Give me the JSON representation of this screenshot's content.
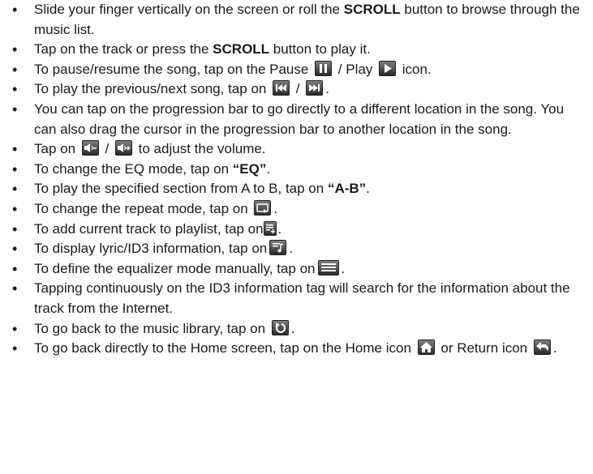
{
  "items": [
    {
      "t1": "Slide your finger vertically on the screen or roll the ",
      "b1": "SCROLL",
      "t2": " button to browse through the music list."
    },
    {
      "t1": "Tap on the track or press the ",
      "b1": "SCROLL",
      "t2": " button to play it."
    },
    {
      "t1": "To pause/resume the song, tap on the Pause ",
      "t2": " / Play ",
      "t3": " icon."
    },
    {
      "t1": "To play the previous/next song, tap on ",
      "t2": " / ",
      "t3": "."
    },
    {
      "t1": "You can tap on the progression bar to go directly to a different location in the song. You can also drag the cursor in the progression bar to another location in the song."
    },
    {
      "t1": "Tap on ",
      "t2": " / ",
      "t3": " to adjust the volume."
    },
    {
      "t1": "To change the EQ mode, tap on ",
      "b1": "“EQ”",
      "t2": "."
    },
    {
      "t1": "To play the specified section from A to B, tap on ",
      "b1": "“A-B”",
      "t2": "."
    },
    {
      "t1": "To change the repeat mode, tap on ",
      "t2": "."
    },
    {
      "t1": "To add current track to playlist, tap on",
      "t2": "."
    },
    {
      "t1": "To display lyric/ID3 information, tap on",
      "t2": "."
    },
    {
      "t1": "To define the equalizer mode manually, tap on",
      "t2": "."
    },
    {
      "t1": "Tapping continuously on the ID3 information tag will search for the information about the track from the Internet."
    },
    {
      "t1": "To go back to the music library, tap on ",
      "t2": "."
    },
    {
      "t1": "To go back directly to the Home screen, tap on the Home icon ",
      "t2": " or Return icon ",
      "t3": "."
    }
  ],
  "icons": {
    "pause": "pause-icon",
    "play": "play-icon",
    "previous": "previous-track-icon",
    "next": "next-track-icon",
    "volume_down": "volume-down-icon",
    "volume_up": "volume-up-icon",
    "repeat": "repeat-icon",
    "add_playlist": "add-to-playlist-icon",
    "lyrics": "lyrics-id3-icon",
    "equalizer": "equalizer-icon",
    "library": "back-to-library-icon",
    "home": "home-icon",
    "return": "return-icon"
  }
}
